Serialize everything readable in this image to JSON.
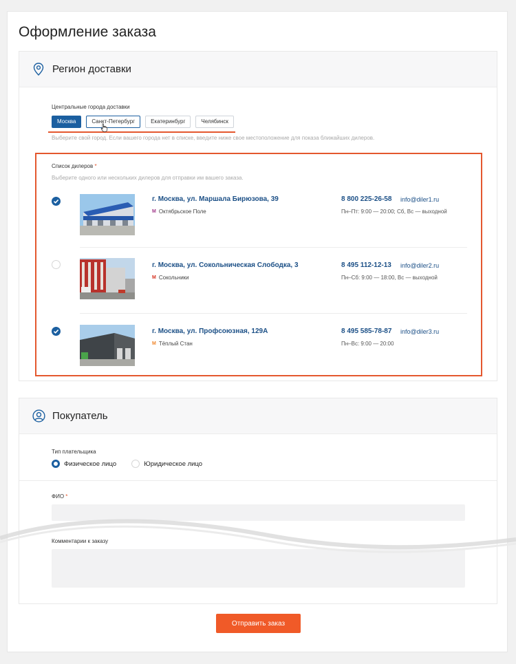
{
  "page": {
    "title": "Оформление заказа"
  },
  "region": {
    "title": "Регион доставки",
    "icon": "map-pin-icon",
    "cities_label": "Центральные города доставки",
    "cities": [
      "Москва",
      "Санкт-Петербург",
      "Екатеринбург",
      "Челябинск"
    ],
    "selected_city": "Москва",
    "cities_hint": "Выберите свой город. Если вашего города нет в списке, введите ниже свое местоположение для показа ближайших дилеров.",
    "dealers_label": "Список дилеров",
    "required_mark": "*",
    "dealers_hint": "Выберите одного или нескольких дилеров для отправки им вашего заказа.",
    "dealers": [
      {
        "checked": true,
        "address": "г. Москва, ул. Маршала Бирюзова, 39",
        "metro": "Октябрьское Поле",
        "metro_color": "#a1398b",
        "phone": "8 800 225-26-58",
        "email": "info@diler1.ru",
        "hours": "Пн–Пт: 9:00 — 20:00; Сб, Вс — выходной"
      },
      {
        "checked": false,
        "address": "г. Москва, ул. Сокольническая Слободка, 3",
        "metro": "Сокольники",
        "metro_color": "#d6311f",
        "phone": "8 495 112-12-13",
        "email": "info@diler2.ru",
        "hours": "Пн–Сб: 9:00 — 18:00, Вс — выходной"
      },
      {
        "checked": true,
        "address": "г. Москва, ул. Профсоюзная, 129А",
        "metro": "Тёплый Стан",
        "metro_color": "#f0862b",
        "phone": "8 495 585-78-87",
        "email": "info@diler3.ru",
        "hours": "Пн–Вс: 9:00 — 20:00"
      }
    ]
  },
  "buyer": {
    "title": "Покупатель",
    "icon": "user-icon",
    "payer_type_label": "Тип плательщика",
    "payer_options": [
      "Физическое лицо",
      "Юридическое лицо"
    ],
    "selected_payer": "Физическое лицо",
    "fio_label": "ФИО",
    "fio_value": "",
    "comment_label": "Комментарии к заказу",
    "comment_value": ""
  },
  "submit_label": "Отправить заказ",
  "colors": {
    "primary": "#1b5fa0",
    "accent": "#f05a28",
    "link": "#1b4f86"
  }
}
